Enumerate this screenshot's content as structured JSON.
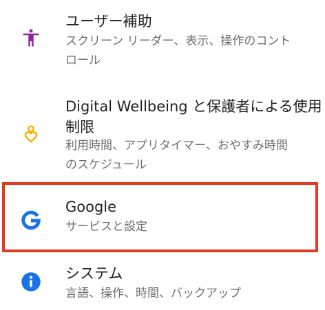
{
  "settings": {
    "items": [
      {
        "title": "ユーザー補助",
        "summary_lines": [
          "スクリーン リーダー、表示、操作のコント",
          "ロール"
        ],
        "icon": "accessibility-icon",
        "color": "#8e24aa"
      },
      {
        "title_lines": [
          "Digital Wellbeing と保護者による使用",
          "制限"
        ],
        "summary_lines": [
          "利用時間、アプリタイマー、おやすみ時間",
          "のスケジュール"
        ],
        "icon": "digital-wellbeing-icon",
        "color": "#f4b400"
      },
      {
        "title": "Google",
        "summary": "サービスと設定",
        "icon": "google-icon",
        "color": "#1a73e8"
      },
      {
        "title": "システム",
        "summary": "言語、操作、時間、バックアップ",
        "icon": "info-icon",
        "color": "#1a73e8"
      }
    ]
  },
  "highlight": {
    "color": "#e23a1e"
  }
}
